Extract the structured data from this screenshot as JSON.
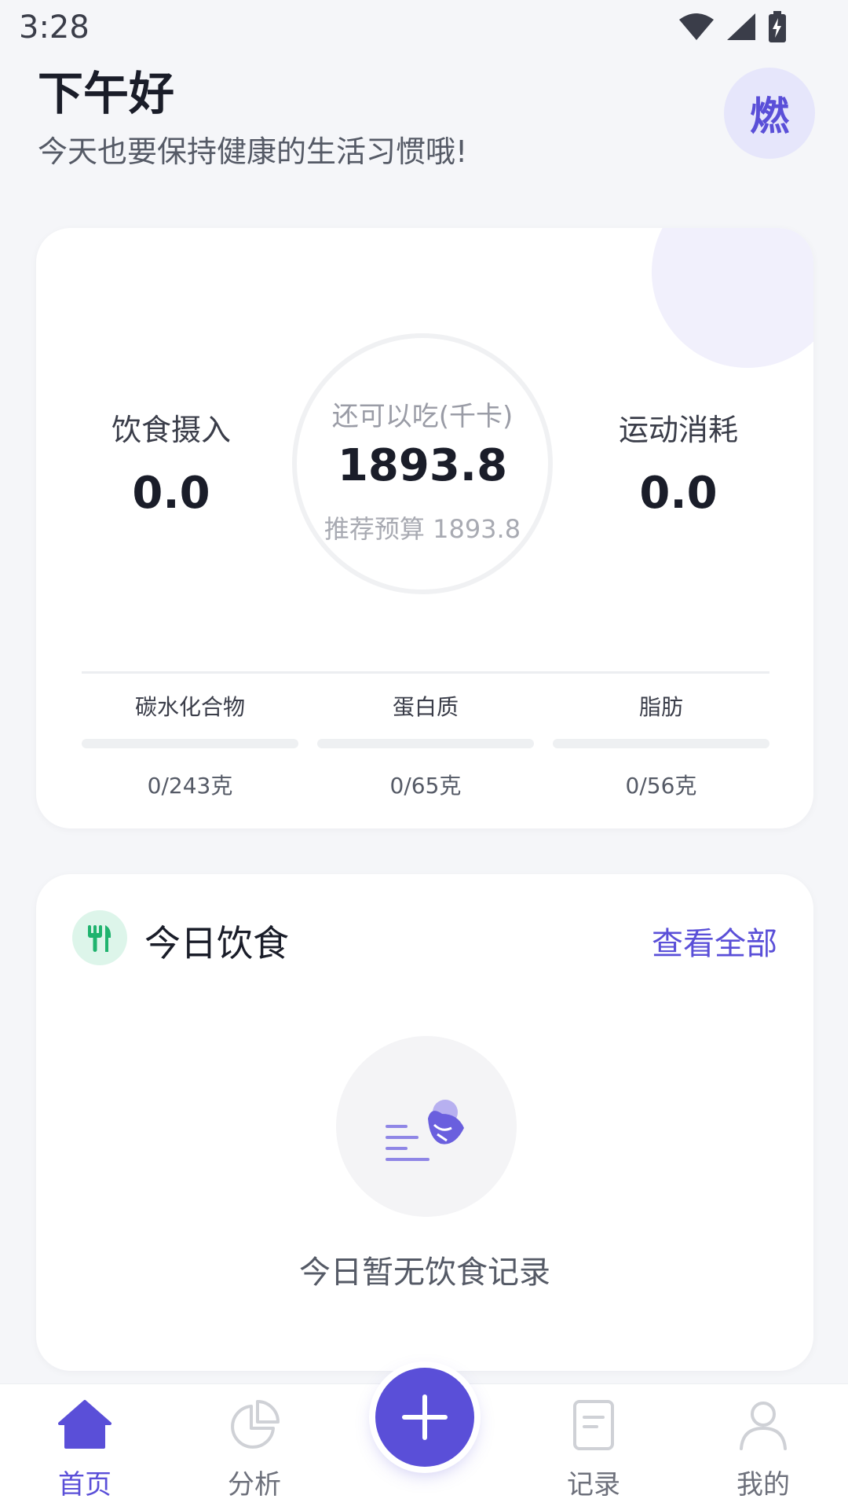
{
  "status_bar": {
    "time": "3:28"
  },
  "header": {
    "greeting": "下午好",
    "subtitle": "今天也要保持健康的生活习惯哦!",
    "badge": "燃"
  },
  "summary": {
    "intake_label": "饮食摄入",
    "intake_value": "0.0",
    "remaining_label": "还可以吃(千卡)",
    "remaining_value": "1893.8",
    "budget_text": "推荐预算 1893.8",
    "exercise_label": "运动消耗",
    "exercise_value": "0.0",
    "macros": [
      {
        "label": "碳水化合物",
        "amount": "0/243克",
        "progress": 0
      },
      {
        "label": "蛋白质",
        "amount": "0/65克",
        "progress": 0
      },
      {
        "label": "脂肪",
        "amount": "0/56克",
        "progress": 0
      }
    ]
  },
  "diet": {
    "title": "今日饮食",
    "view_all": "查看全部",
    "empty_text": "今日暂无饮食记录"
  },
  "tabs": [
    {
      "label": "首页",
      "icon": "home-icon",
      "active": true
    },
    {
      "label": "分析",
      "icon": "pie-chart-icon",
      "active": false
    },
    {
      "label": "记录",
      "icon": "document-icon",
      "active": false
    },
    {
      "label": "我的",
      "icon": "user-icon",
      "active": false
    }
  ],
  "colors": {
    "accent": "#5a4fd8",
    "background": "#f5f6f9",
    "diet_icon_bg": "#ddf5ea",
    "diet_icon": "#1fb36e"
  }
}
